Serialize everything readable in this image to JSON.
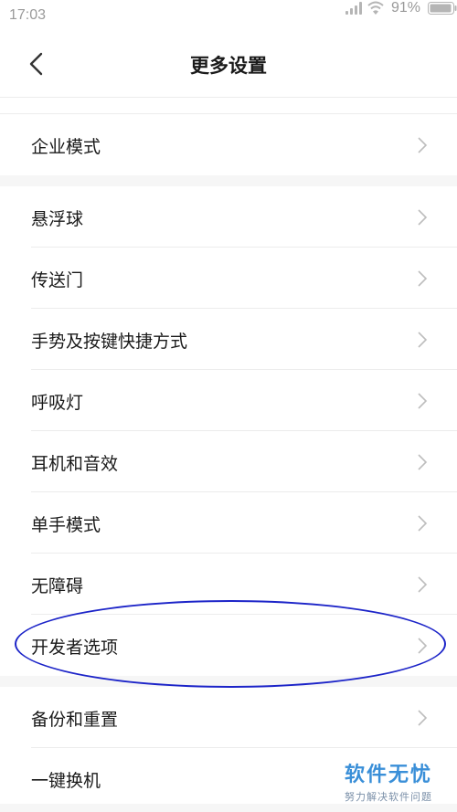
{
  "status_bar": {
    "time": "17:03",
    "battery": "91%"
  },
  "header": {
    "title": "更多设置"
  },
  "rows": [
    {
      "label": "企业模式"
    },
    {
      "label": "悬浮球"
    },
    {
      "label": "传送门"
    },
    {
      "label": "手势及按键快捷方式"
    },
    {
      "label": "呼吸灯"
    },
    {
      "label": "耳机和音效"
    },
    {
      "label": "单手模式"
    },
    {
      "label": "无障碍"
    },
    {
      "label": "开发者选项"
    },
    {
      "label": "备份和重置"
    },
    {
      "label": "一键换机"
    }
  ],
  "annotation": {
    "color": "#1c24c8",
    "target": "开发者选项"
  },
  "watermark": {
    "title": "软件无忧",
    "subtitle": "努力解决软件问题"
  }
}
